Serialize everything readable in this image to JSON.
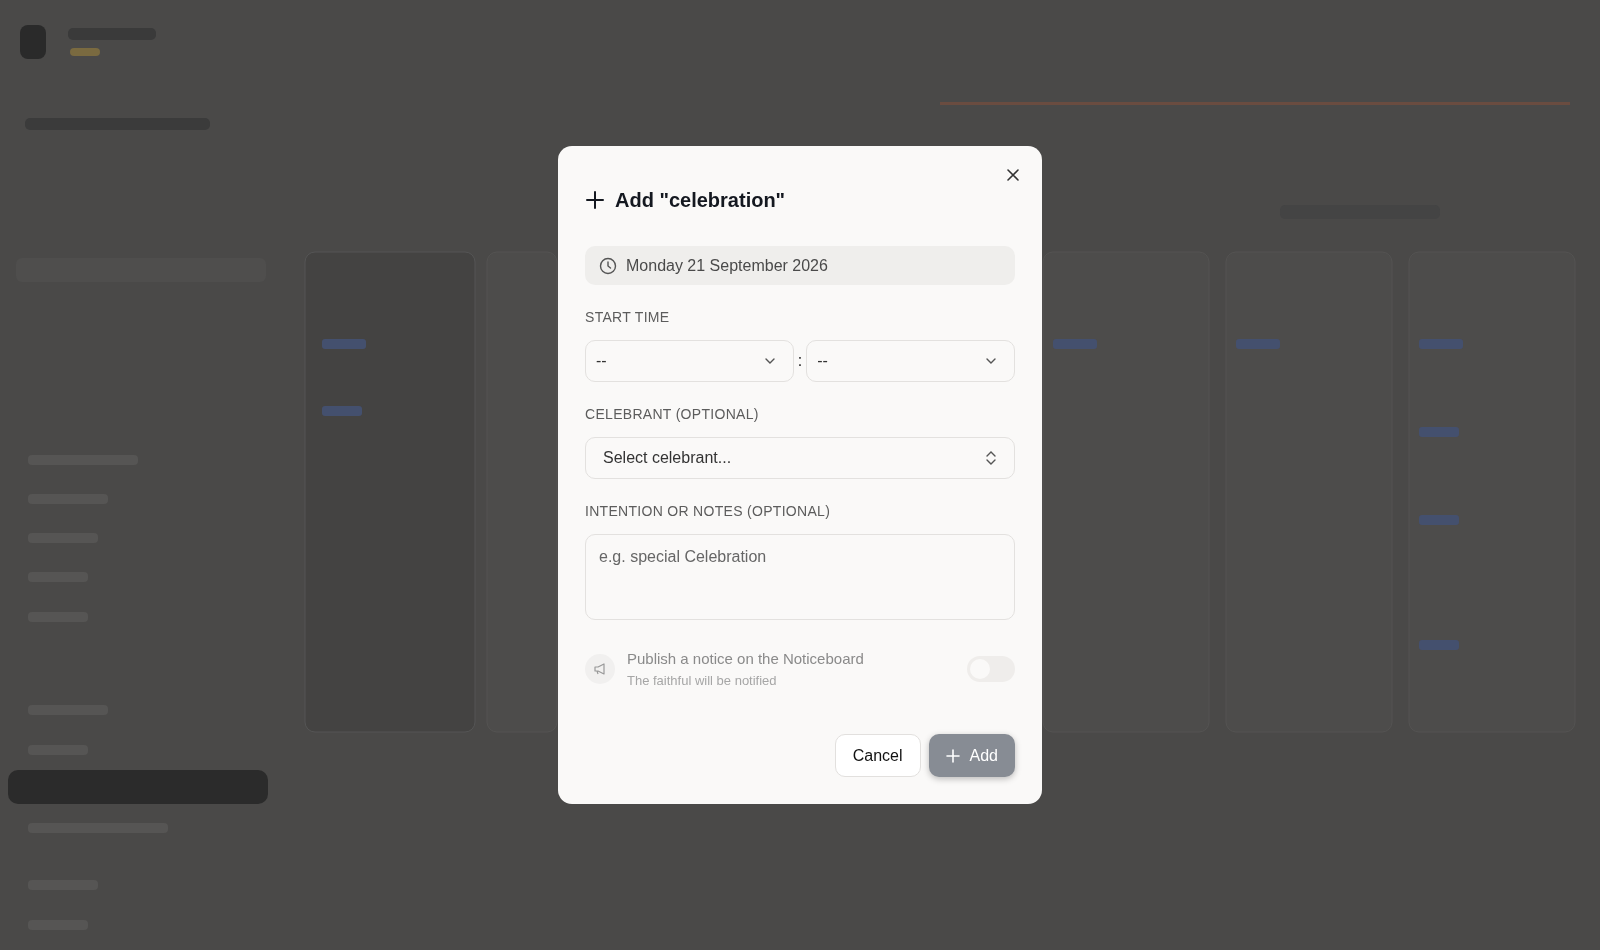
{
  "dialog": {
    "title": "Add \"celebration\"",
    "date": "Monday 21 September 2026",
    "start_time": {
      "label": "START TIME",
      "hour": "--",
      "separator": ":",
      "minute": "--"
    },
    "celebrant": {
      "label": "CELEBRANT (OPTIONAL)",
      "placeholder": "Select celebrant..."
    },
    "notes": {
      "label": "INTENTION OR NOTES (OPTIONAL)",
      "placeholder": "e.g. special Celebration"
    },
    "notice": {
      "title": "Publish a notice on the Noticeboard",
      "subtitle": "The faithful will be notified",
      "on": false,
      "disabled": true
    },
    "buttons": [
      {
        "label": "Cancel",
        "kind": "secondary"
      },
      {
        "label": "Add",
        "kind": "primary",
        "disabled": true
      }
    ]
  }
}
